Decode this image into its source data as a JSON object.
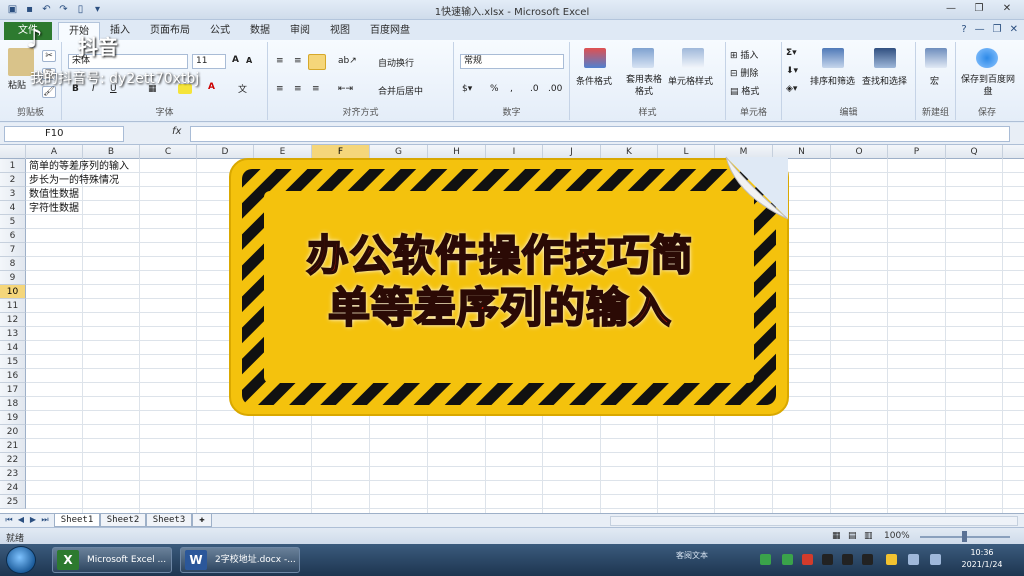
{
  "window": {
    "title": "1快速输入.xlsx - Microsoft Excel"
  },
  "ribbon_tabs": [
    "文件",
    "开始",
    "插入",
    "页面布局",
    "公式",
    "数据",
    "审阅",
    "视图",
    "百度网盘"
  ],
  "ribbon": {
    "clipboard": {
      "paste": "粘贴",
      "label": "剪贴板"
    },
    "font": {
      "name": "宋体",
      "size": "11",
      "label": "字体",
      "bold": "B",
      "italic": "I",
      "underline": "U"
    },
    "alignment": {
      "wrap": "自动换行",
      "merge": "合并后居中",
      "label": "对齐方式"
    },
    "number": {
      "format": "常规",
      "label": "数字",
      "percent": "%",
      "comma": ","
    },
    "styles": {
      "conditional": "条件格式",
      "table": "套用表格格式",
      "cell": "单元格样式",
      "label": "样式"
    },
    "cells": {
      "insert": "插入",
      "delete": "删除",
      "format": "格式",
      "label": "单元格"
    },
    "editing": {
      "sort": "排序和筛选",
      "find": "查找和选择",
      "label": "编辑"
    },
    "new_group": {
      "macro": "宏",
      "label": "新建组"
    },
    "save": {
      "button": "保存到百度网盘",
      "label": "保存"
    }
  },
  "formula_bar": {
    "name_box": "F10",
    "fx": "fx",
    "formula": ""
  },
  "columns": [
    "A",
    "B",
    "C",
    "D",
    "E",
    "F",
    "G",
    "H",
    "I",
    "J",
    "K",
    "L",
    "M",
    "N",
    "O",
    "P",
    "Q"
  ],
  "selected_column": "F",
  "rows": [
    "1",
    "2",
    "3",
    "4",
    "5",
    "6",
    "7",
    "8",
    "9",
    "10",
    "11",
    "12",
    "13",
    "14",
    "15",
    "16",
    "17",
    "18",
    "19",
    "20",
    "21",
    "22",
    "23",
    "24",
    "25"
  ],
  "selected_row": "10",
  "cells": {
    "A1": "简单的等差序列的输入",
    "A2": "步长为一的特殊情况",
    "A3": "数值性数据",
    "A4": "字符性数据"
  },
  "sheet_tabs": [
    "Sheet1",
    "Sheet2",
    "Sheet3"
  ],
  "status": {
    "ready": "就绪",
    "zoom": "100%"
  },
  "watermark": {
    "brand": "抖音",
    "id": "我的抖音号: dy2ett70xtbj"
  },
  "banner": {
    "line1": "办公软件操作技巧简",
    "line2": "单等差序列的输入"
  },
  "taskbar": {
    "tasks": [
      {
        "label": "Microsoft Excel ...",
        "icon": "X"
      },
      {
        "label": "2字校地址.docx -...",
        "icon": "W"
      }
    ],
    "tray_text": "客阅文本",
    "time": "10:36",
    "date": "2021/1/24"
  },
  "colors": {
    "file_tab": "#2d7a2f",
    "selection": "#f5d67a",
    "banner_yellow": "#f4c20d",
    "banner_text": "#e02414"
  }
}
